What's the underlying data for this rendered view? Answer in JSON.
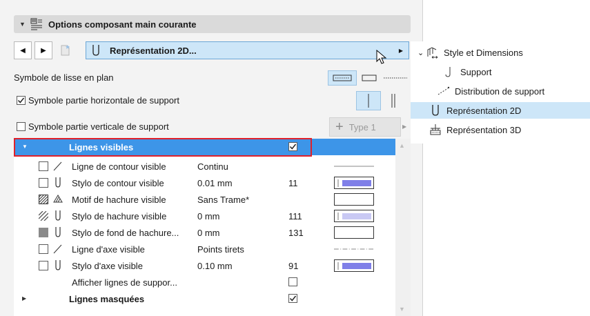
{
  "panel": {
    "title": "Options composant main courante",
    "representation_select": "Représentation 2D...",
    "rows": {
      "lisse_label": "Symbole de lisse en plan",
      "horizontal_label": "Symbole partie horizontale de support",
      "horizontal_checked": true,
      "vertical_label": "Symbole partie verticale de support",
      "vertical_checked": false,
      "type_button": "Type 1"
    }
  },
  "table": {
    "visible_header": {
      "label": "Lignes visibles",
      "checked": true
    },
    "rows": [
      {
        "label": "Ligne de contour visible",
        "value": "Continu",
        "num": "",
        "control": "solid-line"
      },
      {
        "label": "Stylo de contour visible",
        "value": "0.01 mm",
        "num": "11",
        "control": "pen-dark"
      },
      {
        "label": "Motif de hachure visible",
        "value": "Sans Trame*",
        "num": "",
        "control": "empty"
      },
      {
        "label": "Stylo de hachure visible",
        "value": "0 mm",
        "num": "111",
        "control": "pen-light"
      },
      {
        "label": "Stylo de fond de hachure...",
        "value": "0 mm",
        "num": "131",
        "control": "empty"
      },
      {
        "label": "Ligne d'axe visible",
        "value": "Points tirets",
        "num": "",
        "control": "dash-dot-line"
      },
      {
        "label": "Stylo d'axe visible",
        "value": "0.10 mm",
        "num": "91",
        "control": "pen-dark"
      },
      {
        "label": "Afficher lignes de suppor...",
        "value": "",
        "num": "",
        "control": "checkbox-unchecked"
      }
    ],
    "hidden_header": {
      "label": "Lignes masquées",
      "checked": true
    }
  },
  "tree": {
    "items": [
      {
        "label": "Style et Dimensions",
        "icon": "style-dimensions-icon",
        "expanded": true
      },
      {
        "label": "Support",
        "icon": "support-icon"
      },
      {
        "label": "Distribution de support",
        "icon": "distribution-icon"
      },
      {
        "label": "Représentation 2D",
        "icon": "representation-2d-icon",
        "selected": true
      },
      {
        "label": "Représentation 3D",
        "icon": "representation-3d-icon"
      }
    ]
  },
  "colors": {
    "selection_blue": "#3d95e8",
    "light_selection": "#cde6f8",
    "highlight_red": "#e0202a",
    "pen_swatch": "#7f7fe8"
  }
}
